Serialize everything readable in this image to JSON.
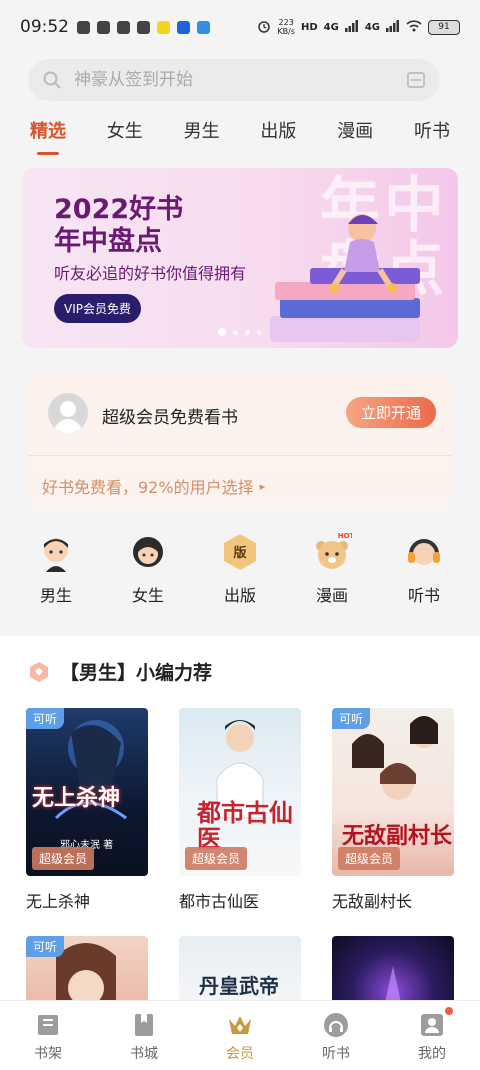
{
  "status_bar": {
    "time": "09:52",
    "net_speed_top": "223",
    "net_speed_bottom": "KB/s",
    "hd": "HD",
    "net1": "4G",
    "net2": "4G",
    "battery": "91"
  },
  "search": {
    "placeholder": "神豪从签到开始"
  },
  "tabs": [
    {
      "label": "精选",
      "active": true
    },
    {
      "label": "女生"
    },
    {
      "label": "男生"
    },
    {
      "label": "出版"
    },
    {
      "label": "漫画"
    },
    {
      "label": "听书"
    }
  ],
  "banner": {
    "title_line1": "2022好书",
    "title_line2": "年中盘点",
    "subtitle": "听友必追的好书你值得拥有",
    "button": "VIP会员免费",
    "big_text": "年中\n盘点"
  },
  "vip": {
    "text": "超级会员免费看书",
    "button": "立即开通",
    "promo": "好书免费看，92%的用户选择"
  },
  "categories": [
    {
      "label": "男生",
      "icon": "boy-icon"
    },
    {
      "label": "女生",
      "icon": "girl-icon"
    },
    {
      "label": "出版",
      "icon": "publish-icon",
      "glyph": "版"
    },
    {
      "label": "漫画",
      "icon": "comic-icon",
      "hot": "HOT"
    },
    {
      "label": "听书",
      "icon": "headphone-icon"
    }
  ],
  "section": {
    "title": "【男生】小编力荐",
    "books": [
      {
        "name": "无上杀神",
        "listen": "可听",
        "vip": "超级会员",
        "cover_text": "无上杀神",
        "author": "邪心未泯 著"
      },
      {
        "name": "都市古仙医",
        "vip": "超级会员",
        "cover_text": "都市古仙医"
      },
      {
        "name": "无敌副村长",
        "listen": "可听",
        "vip": "超级会员",
        "cover_text": "无敌副村长"
      }
    ],
    "row2": [
      {
        "listen": "可听"
      },
      {
        "cover_text": "丹皇武帝"
      },
      {}
    ]
  },
  "bottom_nav": [
    {
      "label": "书架",
      "icon": "bookshelf-icon"
    },
    {
      "label": "书城",
      "icon": "bookstore-icon"
    },
    {
      "label": "会员",
      "icon": "crown-icon",
      "active": true
    },
    {
      "label": "听书",
      "icon": "headphone-nav-icon"
    },
    {
      "label": "我的",
      "icon": "profile-icon"
    }
  ],
  "colors": {
    "accent": "#d9542c",
    "vip_gold": "#c89a3f",
    "listen_badge": "#5f9fe8",
    "banner_text": "#6a1a73"
  }
}
